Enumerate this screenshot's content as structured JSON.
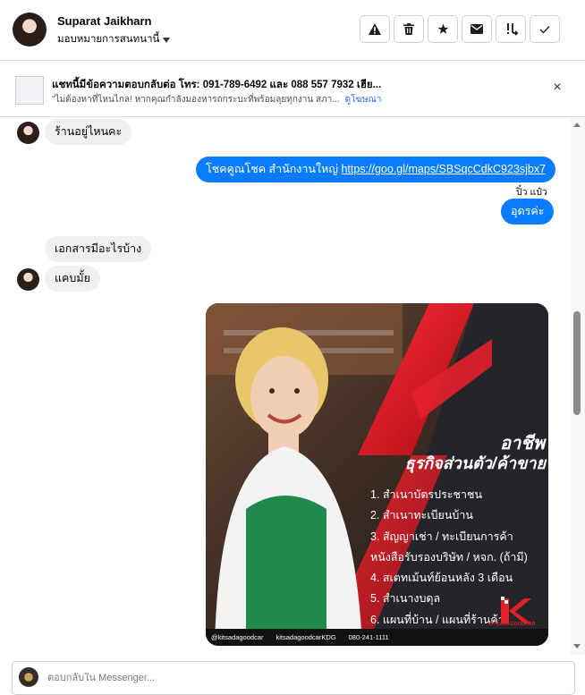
{
  "header": {
    "name": "Suparat Jaikharn",
    "assign_label": "มอบหมายการสนทนานี้",
    "actions": [
      {
        "icon": "warning-icon",
        "glyph": "⚠"
      },
      {
        "icon": "trash-icon",
        "glyph": "🗑"
      },
      {
        "icon": "star-icon",
        "glyph": "★"
      },
      {
        "icon": "mail-icon",
        "glyph": "✉"
      },
      {
        "icon": "follow-up-icon",
        "glyph": "!↴"
      },
      {
        "icon": "check-icon",
        "glyph": "✓"
      }
    ]
  },
  "banner": {
    "title": "แชทนี้มีข้อความตอบกลับต่อ โทร: 091-789-6492 และ 088 557 7932 เฮีย...",
    "subtitle": "\"ไม่ต้องหาที่ไหนไกล! หากคุณกำลังมองหารถกระบะที่พร้อมลุยทุกงาน สภา...",
    "link": "ดูโฆษณา",
    "close": "×"
  },
  "messages": {
    "m1": "ร้านอยู่ไหนคะ",
    "m2_prefix": "โชคคูณโชค สำนักงานใหญ่ ",
    "m2_link": "https://goo.gl/maps/SBSqcCdkC923sjbx7",
    "sender": "ปิ๋ว แป๋ว",
    "m3": "อุดรค่ะ",
    "m4": "เอกสารมีอะไรบ้าง",
    "m5": "แคบมั้ย"
  },
  "ad": {
    "title1": "อาชีพ",
    "title2": "ธุรกิจส่วนตัว/ค้าขาย",
    "items": [
      "1. สำเนาบัตรประชาชน",
      "2. สำเนาทะเบียนบ้าน",
      "3. สัญญาเช่า / ทะเบียนการค้า",
      "หนังสือรับรองบริษัท / หจก. (ถ้ามี)",
      "4. สเตทเม้นท์ย้อนหลัง 3 เดือน",
      "5. สำเนางบดุล",
      "6. แผนที่บ้าน / แผนที่ร้านค้า"
    ],
    "footer": {
      "line": "@kitsadagoodcar",
      "facebook": "kitsadagoodcarKDG",
      "phone": "080-241-1111"
    },
    "logo_text": "KITSADAGOODCAR"
  },
  "composer": {
    "placeholder": "ตอบกลับใน Messenger..."
  }
}
